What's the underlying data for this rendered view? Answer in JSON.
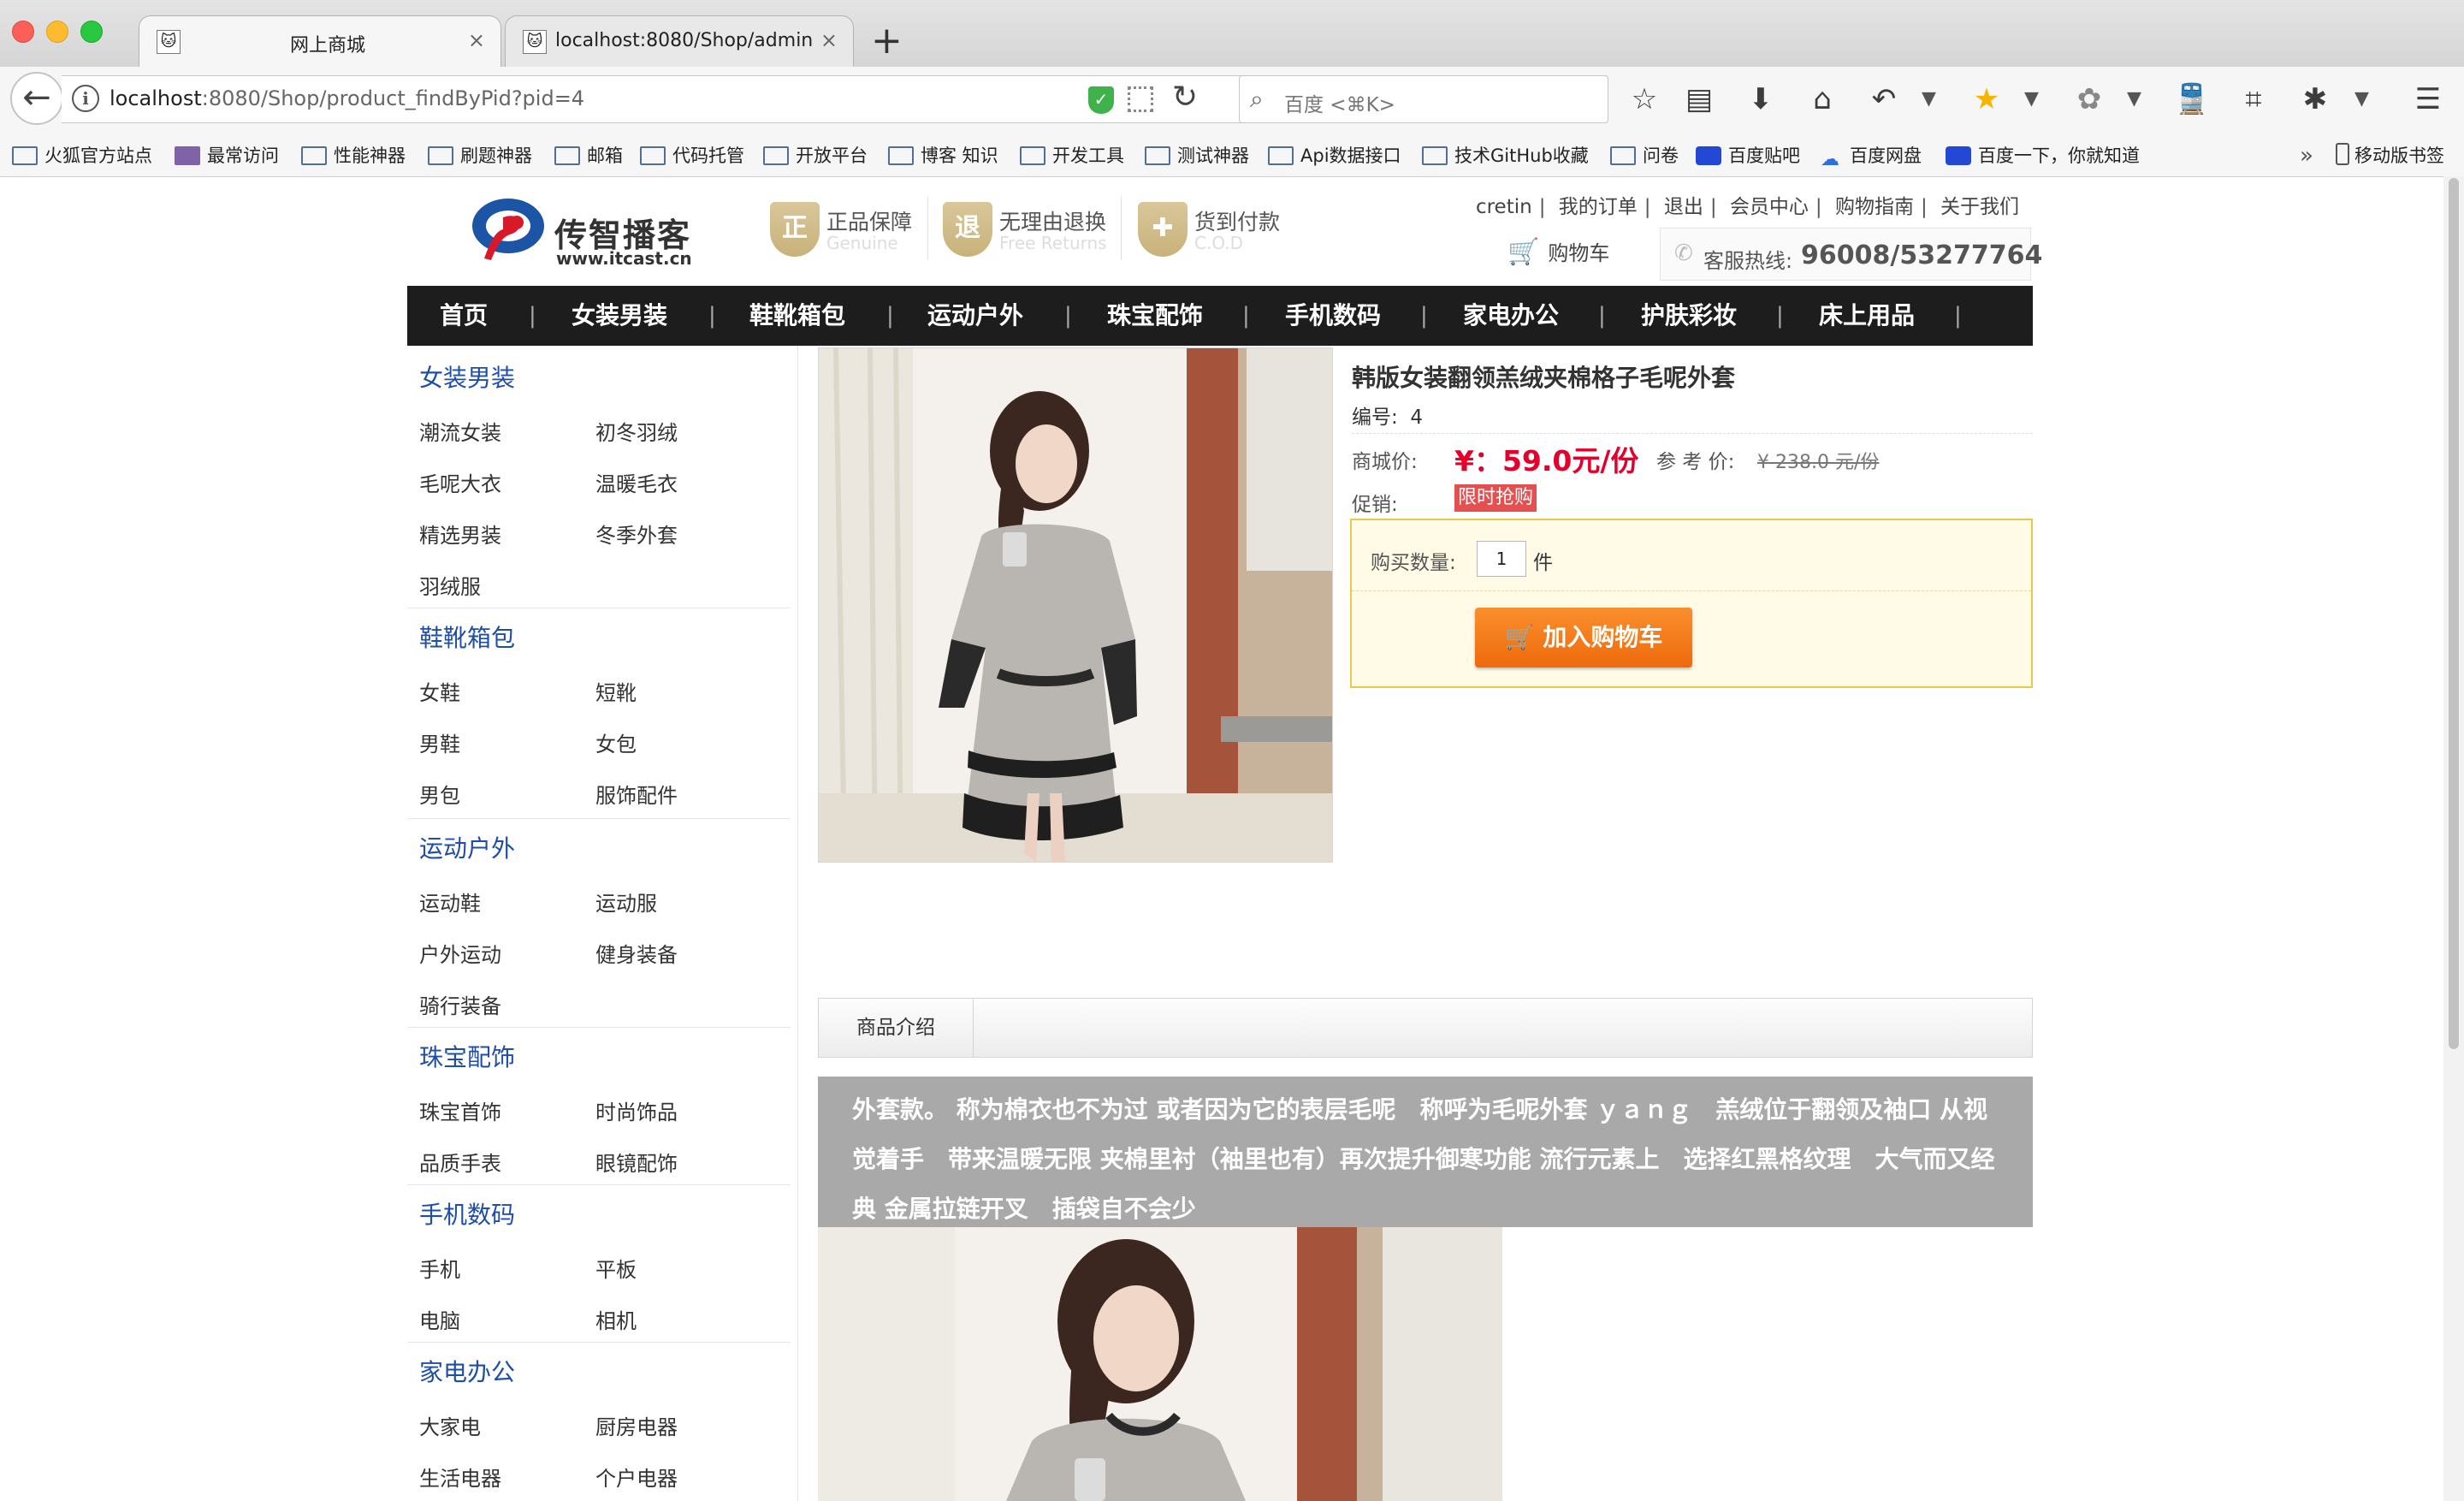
{
  "browser": {
    "tabs": [
      {
        "title": "网上商城",
        "active": true
      },
      {
        "title": "localhost:8080/Shop/admin/",
        "active": false
      }
    ],
    "new_tab": "+",
    "url_host": "localhost",
    "url_rest": ":8080/Shop/product_findByPid?pid=4",
    "search_placeholder": "百度 <⌘K>",
    "bookmarks": [
      "火狐官方站点",
      "最常访问",
      "性能神器",
      "刷题神器",
      "邮箱",
      "代码托管",
      "开放平台",
      "博客 知识",
      "开发工具",
      "测试神器",
      "Api数据接口",
      "技术GitHub收藏",
      "问卷",
      "百度贴吧",
      "百度网盘",
      "百度一下，你就知道"
    ],
    "bookmarks_overflow": "»",
    "mobile_bookmarks": "移动版书签"
  },
  "header": {
    "logo_text": "传智播客",
    "logo_url": "www.itcast.cn",
    "badges": [
      {
        "title": "正品保障",
        "sub": "Genuine",
        "icon": "正"
      },
      {
        "title": "无理由退换",
        "sub": "Free Returns",
        "icon": "退"
      },
      {
        "title": "货到付款",
        "sub": "C.O.D",
        "icon": "✚"
      }
    ],
    "top_links": [
      "cretin",
      "我的订单",
      "退出",
      "会员中心",
      "购物指南",
      "关于我们"
    ],
    "link_sep": "|",
    "cart": "购物车",
    "hotline_label": "客服热线:",
    "hotline_number": "96008/53277764"
  },
  "nav": {
    "items": [
      "首页",
      "女装男装",
      "鞋靴箱包",
      "运动户外",
      "珠宝配饰",
      "手机数码",
      "家电办公",
      "护肤彩妆",
      "床上用品"
    ],
    "sep": "|"
  },
  "sidebar": {
    "categories": [
      {
        "title": "女装男装",
        "items": [
          "潮流女装",
          "初冬羽绒",
          "毛呢大衣",
          "温暖毛衣",
          "精选男装",
          "冬季外套",
          "羽绒服"
        ]
      },
      {
        "title": "鞋靴箱包",
        "items": [
          "女鞋",
          "短靴",
          "男鞋",
          "女包",
          "男包",
          "服饰配件"
        ]
      },
      {
        "title": "运动户外",
        "items": [
          "运动鞋",
          "运动服",
          "户外运动",
          "健身装备",
          "骑行装备"
        ]
      },
      {
        "title": "珠宝配饰",
        "items": [
          "珠宝首饰",
          "时尚饰品",
          "品质手表",
          "眼镜配饰"
        ]
      },
      {
        "title": "手机数码",
        "items": [
          "手机",
          "平板",
          "电脑",
          "相机"
        ]
      },
      {
        "title": "家电办公",
        "items": [
          "大家电",
          "厨房电器",
          "生活电器",
          "个户电器"
        ]
      }
    ]
  },
  "product": {
    "name": "韩版女装翻领羔绒夹棉格子毛呢外套",
    "sn_label": "编号:",
    "sn": "4",
    "price_label": "商城价:",
    "price": "¥：59.0元/份",
    "ref_label": "参 考 价:",
    "ref_price": "¥ 238.0 元/份",
    "promo_label": "促销:",
    "promo": "限时抢购",
    "qty_label": "购买数量:",
    "qty": "1",
    "qty_unit": "件",
    "add_to_cart": "加入购物车",
    "intro_tab": "商品介绍",
    "description": "外套款。 称为棉衣也不为过 或者因为它的表层毛呢　称呼为毛呢外套 ｙａｎｇ　羔绒位于翻领及袖口 从视觉着手　带来温暖无限 夹棉里衬（袖里也有）再次提升御寒功能 流行元素上　选择红黑格纹理　大气而又经典 金属拉链开叉　插袋自不会少"
  },
  "colors": {
    "nav_bg": "#1d1d1d",
    "category_blue": "#1f4ea7",
    "price_red": "#e4002b",
    "cart_button": "#f17a1c",
    "buybox_border": "#e9c94b"
  }
}
